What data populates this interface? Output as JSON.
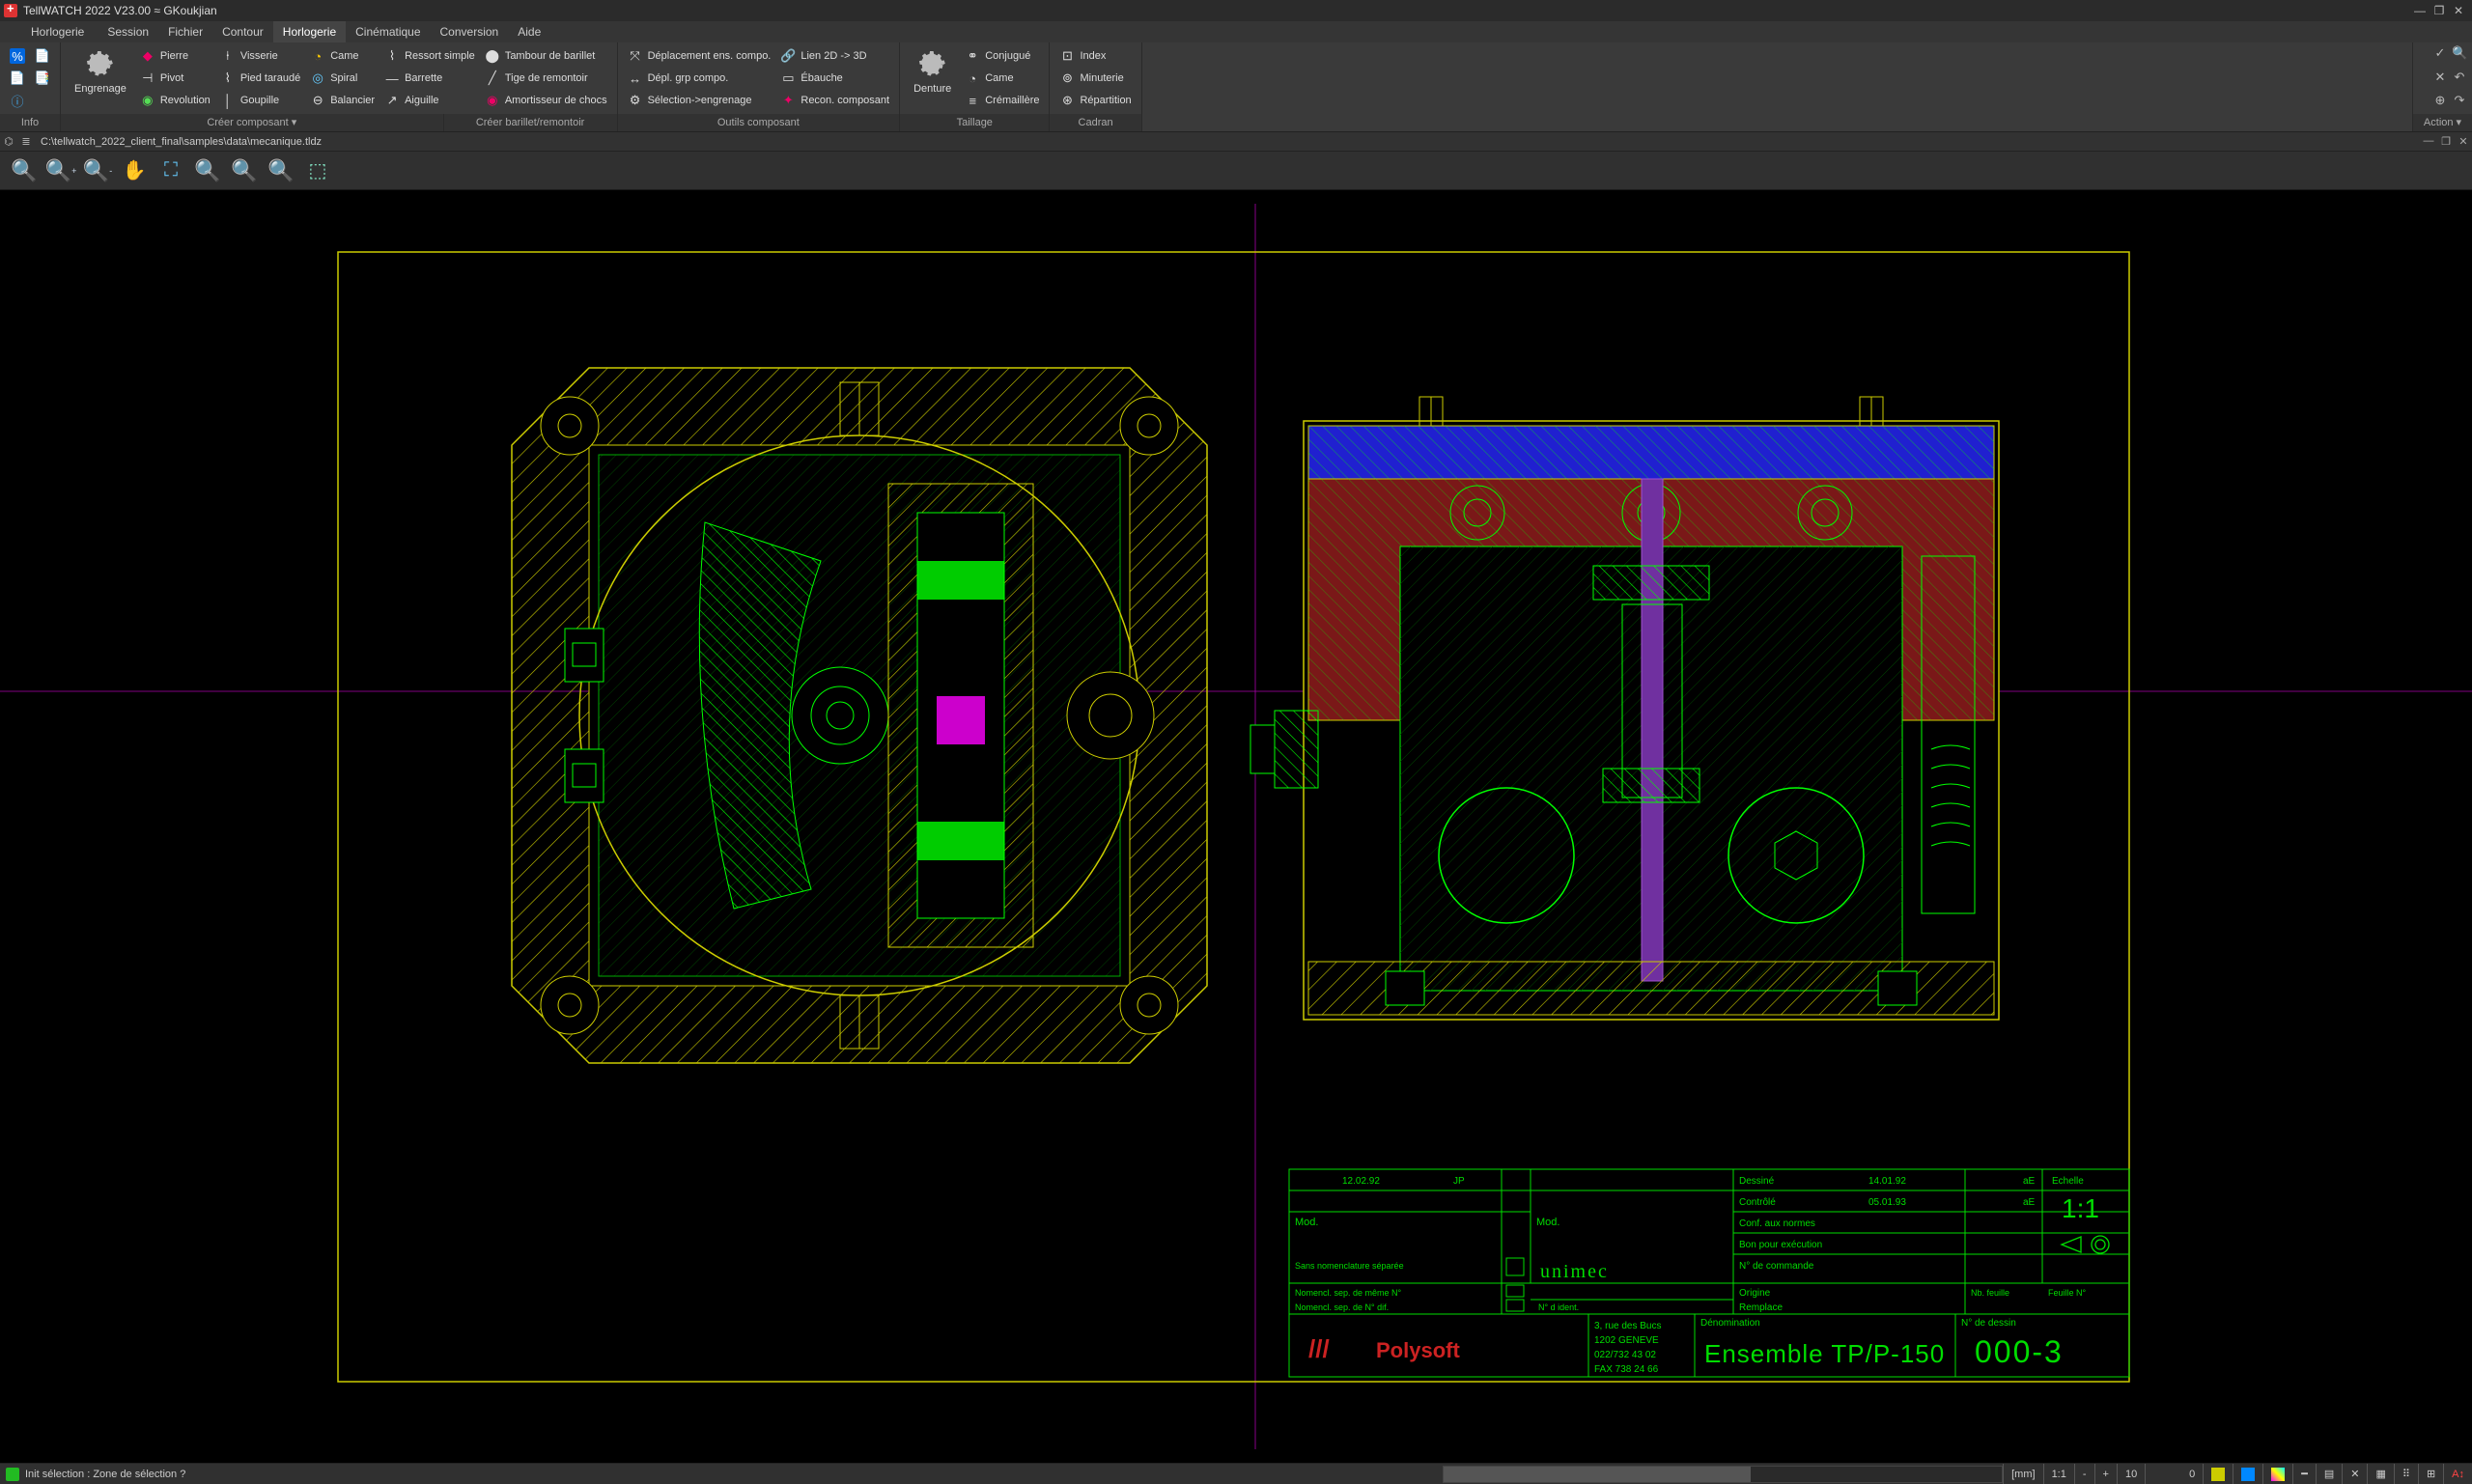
{
  "title": "TellWATCH 2022 V23.00 ≈ GKoukjian",
  "menus": [
    "Horlogerie",
    "Session",
    "Fichier",
    "Contour",
    "Horlogerie",
    "Cinématique",
    "Conversion",
    "Aide"
  ],
  "activeMenuIndex": 4,
  "ribbon": {
    "info": {
      "caption": "Info"
    },
    "creer": {
      "caption": "Créer composant ▾",
      "big": "Engrenage",
      "col1": [
        "Pierre",
        "Pivot",
        "Revolution"
      ],
      "col2": [
        "Visserie",
        "Pied taraudé",
        "Goupille"
      ],
      "col3": [
        "Came",
        "Spiral",
        "Balancier"
      ],
      "col4": [
        "Ressort simple",
        "Barrette",
        "Aiguille"
      ],
      "col5": [
        "Tambour de barillet",
        "Tige de remontoir",
        "Amortisseur de chocs"
      ]
    },
    "barillet": {
      "caption": "Créer barillet/remontoir"
    },
    "outils": {
      "caption": "Outils composant",
      "col1": [
        "Déplacement ens. compo.",
        "Dépl. grp compo.",
        "Sélection->engrenage"
      ],
      "col2": [
        "Lien 2D -> 3D",
        "Ébauche",
        "Recon. composant"
      ]
    },
    "taillage": {
      "caption": "Taillage",
      "big": "Denture",
      "col": [
        "Conjugué",
        "Came",
        "Crémaillère"
      ]
    },
    "cadran": {
      "caption": "Cadran",
      "col": [
        "Index",
        "Minuterie",
        "Répartition"
      ]
    },
    "actionCaption": "Action ▾"
  },
  "path": {
    "file": "C:\\tellwatch_2022_client_final\\samples\\data\\mecanique.tldz"
  },
  "status": {
    "prompt": "Init sélection : Zone de sélection ?",
    "unit": "[mm]",
    "scale": "1:1",
    "minus": "-",
    "plus": "+",
    "step": "10",
    "input": "0"
  },
  "drawing": {
    "titleblock": {
      "company": "Polysoft",
      "logo": "unimec",
      "addr1": "3, rue des Bucs",
      "addr2": "1202 GENEVE",
      "addr3": "022/732 43 02",
      "addr4": "FAX 738 24 66",
      "denom_lbl": "Dénomination",
      "denom": "Ensemble TP/P-150",
      "numlbl": "N° de dessin",
      "num": "000-3",
      "scale_lbl": "Echelle",
      "scale": "1:1",
      "mod": "Mod.",
      "date1": "12.02.92",
      "date2": "14.01.92",
      "date3": "05.01.93",
      "dessine": "Dessiné",
      "controle": "Contrôlé",
      "conf": "Conf. aux normes",
      "bon": "Bon pour exécution",
      "cmd": "N° de commande",
      "orig": "Origine",
      "rempl": "Remplace",
      "sep": "Sans nomenclature séparée",
      "nomencl": "Nomencl. sep. de même N°",
      "nomencl2": "Nomencl. sep. de N° dif.",
      "ident": "N° d ident.",
      "nb": "Nb. feuille",
      "feuille": "Feuille N°"
    }
  }
}
